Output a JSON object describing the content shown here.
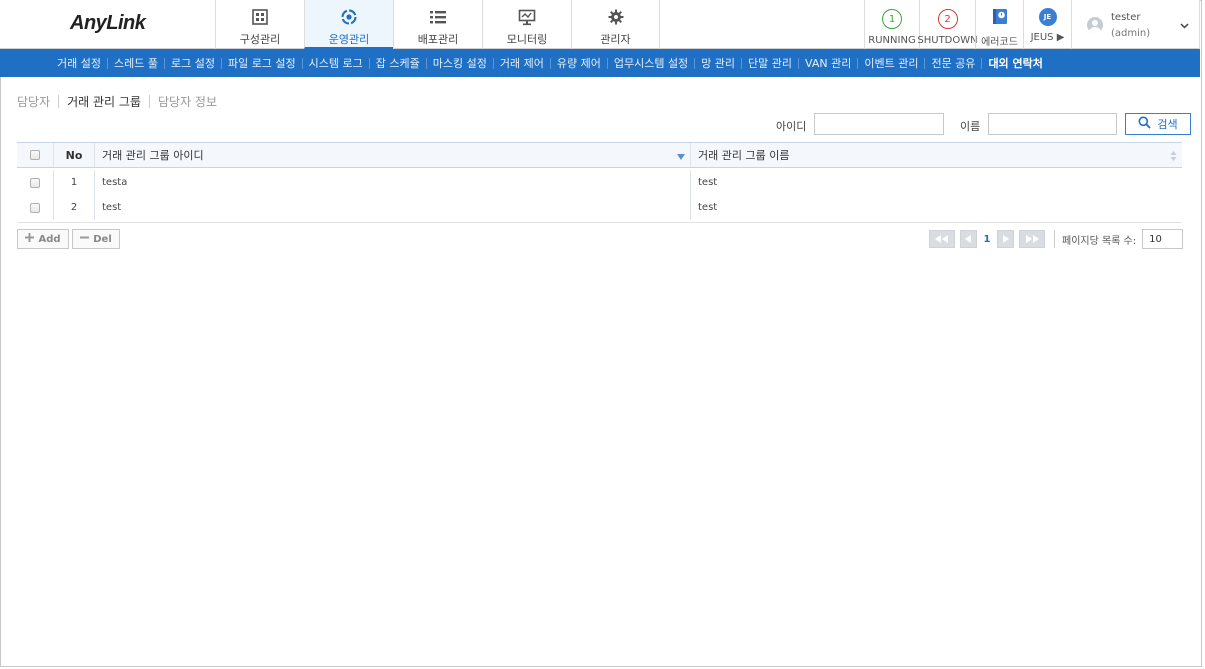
{
  "app": {
    "logo": "AnyLink"
  },
  "topnav": [
    {
      "label": "구성관리",
      "icon": "grid-icon"
    },
    {
      "label": "운영관리",
      "icon": "ops-icon"
    },
    {
      "label": "배포관리",
      "icon": "list-icon"
    },
    {
      "label": "모니터링",
      "icon": "monitor-icon"
    },
    {
      "label": "관리자",
      "icon": "gear-icon"
    }
  ],
  "status": {
    "running": {
      "count": "1",
      "label": "RUNNING",
      "color": "#3aa83a"
    },
    "shutdown": {
      "count": "2",
      "label": "SHUTDOWN",
      "color": "#d63a3a"
    },
    "error": {
      "label": "에러코드",
      "icon": "error-code-icon"
    },
    "jeus": {
      "badge": "JE",
      "label": "JEUS ▶"
    }
  },
  "user": {
    "name": "tester",
    "role": "(admin)"
  },
  "subnav": [
    "거래 설정",
    "스레드 풀",
    "로그 설정",
    "파일 로그 설정",
    "시스템 로그",
    "잡 스케쥴",
    "마스킹 설정",
    "거래 제어",
    "유량 제어",
    "업무시스템 설정",
    "망 관리",
    "단말 관리",
    "VAN 관리",
    "이벤트 관리",
    "전문 공유",
    "대외 연락처"
  ],
  "breadcrumbs": [
    "담당자",
    "거래 관리 그룹",
    "담당자 정보"
  ],
  "search": {
    "id_label": "아이디",
    "id_value": "",
    "name_label": "이름",
    "name_value": "",
    "button": "검색"
  },
  "table": {
    "headers": {
      "no": "No",
      "group_id": "거래 관리 그룹 아이디",
      "group_name": "거래 관리 그룹 이름"
    },
    "rows": [
      {
        "no": "1",
        "group_id": "testa",
        "group_name": "test"
      },
      {
        "no": "2",
        "group_id": "test",
        "group_name": "test"
      }
    ]
  },
  "actions": {
    "add": "Add",
    "del": "Del"
  },
  "pager": {
    "current": "1",
    "per_page_label": "페이지당 목록 수:",
    "per_page": "10"
  },
  "colors": {
    "accent": "#1f6fc5",
    "running": "#3aa83a",
    "shutdown": "#d63a3a"
  }
}
